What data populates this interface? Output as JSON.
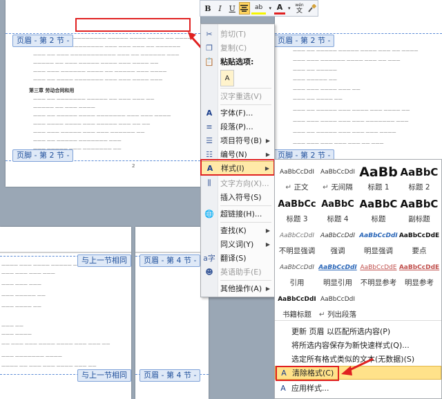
{
  "header_tags": {
    "top_left": "页眉 - 第 2 节 -",
    "top_right": "页眉 - 第 2 节 -",
    "bottom_right_1": "与上一节相同",
    "bottom_mid_1": "页眉 - 第 4 节 -",
    "bottom_right_2": "与上一节相同",
    "bottom_mid_2": "页眉 - 第 4 节 -"
  },
  "footer_tags": {
    "left": "页脚 - 第 2 节 -",
    "right": "页脚 - 第 2 节 -"
  },
  "doc": {
    "heading": "第三章 劳动合同和用",
    "page_number": "2"
  },
  "mini_toolbar": {
    "bold": "B",
    "italic": "I",
    "underline": "U",
    "highlight": "ab",
    "font_color": "A",
    "phonetic": "wén",
    "phonetic_char": "文"
  },
  "context_menu": {
    "cut": "剪切(T)",
    "copy": "复制(C)",
    "paste_options": "粘贴选项:",
    "reconvert": "汉字重选(V)",
    "font": "字体(F)...",
    "paragraph": "段落(P)...",
    "bullets": "项目符号(B)",
    "numbering": "编号(N)",
    "styles": "样式(I)",
    "text_direction": "文字方向(X)...",
    "insert_symbol": "插入符号(S)",
    "hyperlink": "超链接(H)...",
    "lookup": "查找(K)",
    "synonyms": "同义词(Y)",
    "translate": "翻译(S)",
    "english_assistant": "英语助手(E)",
    "other_actions": "其他操作(A)"
  },
  "style_gallery": {
    "styles": [
      {
        "preview": "AaBbCcDdI",
        "name": "正文",
        "marker": true
      },
      {
        "preview": "AaBbCcDdI",
        "name": "无间隔",
        "marker": true
      },
      {
        "preview": "AaBb",
        "name": "标题 1",
        "marker": false
      },
      {
        "preview": "AaBbC",
        "name": "标题 2",
        "marker": false
      },
      {
        "preview": "AaBbCc",
        "name": "标题 3",
        "marker": false
      },
      {
        "preview": "AaBbC",
        "name": "标题 4",
        "marker": false
      },
      {
        "preview": "AaBbC",
        "name": "标题",
        "marker": false
      },
      {
        "preview": "AaBbC",
        "name": "副标题",
        "marker": false
      },
      {
        "preview": "AaBbCcDdI",
        "name": "不明显强调",
        "marker": false
      },
      {
        "preview": "AaBbCcDdI",
        "name": "强调",
        "marker": false
      },
      {
        "preview": "AaBbCcDdI",
        "name": "明显强调",
        "marker": false
      },
      {
        "preview": "AaBbCcDdE",
        "name": "要点",
        "marker": false
      },
      {
        "preview": "AaBbCcDdI",
        "name": "引用",
        "marker": false
      },
      {
        "preview": "AaBbCcDdI",
        "name": "明显引用",
        "marker": false
      },
      {
        "preview": "AaBbCcDdE",
        "name": "不明显参考",
        "marker": false
      },
      {
        "preview": "AaBbCcDdE",
        "name": "明显参考",
        "marker": false
      },
      {
        "preview": "AaBbCcDdI",
        "name": "书籍标题",
        "marker": false
      },
      {
        "preview": "AaBbCcDdI",
        "name": "列出段落",
        "marker": true
      }
    ],
    "update_style": "更新 页眉 以匹配所选内容(P)",
    "save_as_new": "将所选内容保存为新快速样式(Q)...",
    "select_similar": "选定所有格式类似的文本(无数据)(S)",
    "clear_formatting": "清除格式(C)",
    "apply_styles": "应用样式..."
  },
  "colors": {
    "accent_red": "#e02020",
    "tag_blue": "#1f4f9b",
    "highlight_yellow": "#ffe28a"
  }
}
